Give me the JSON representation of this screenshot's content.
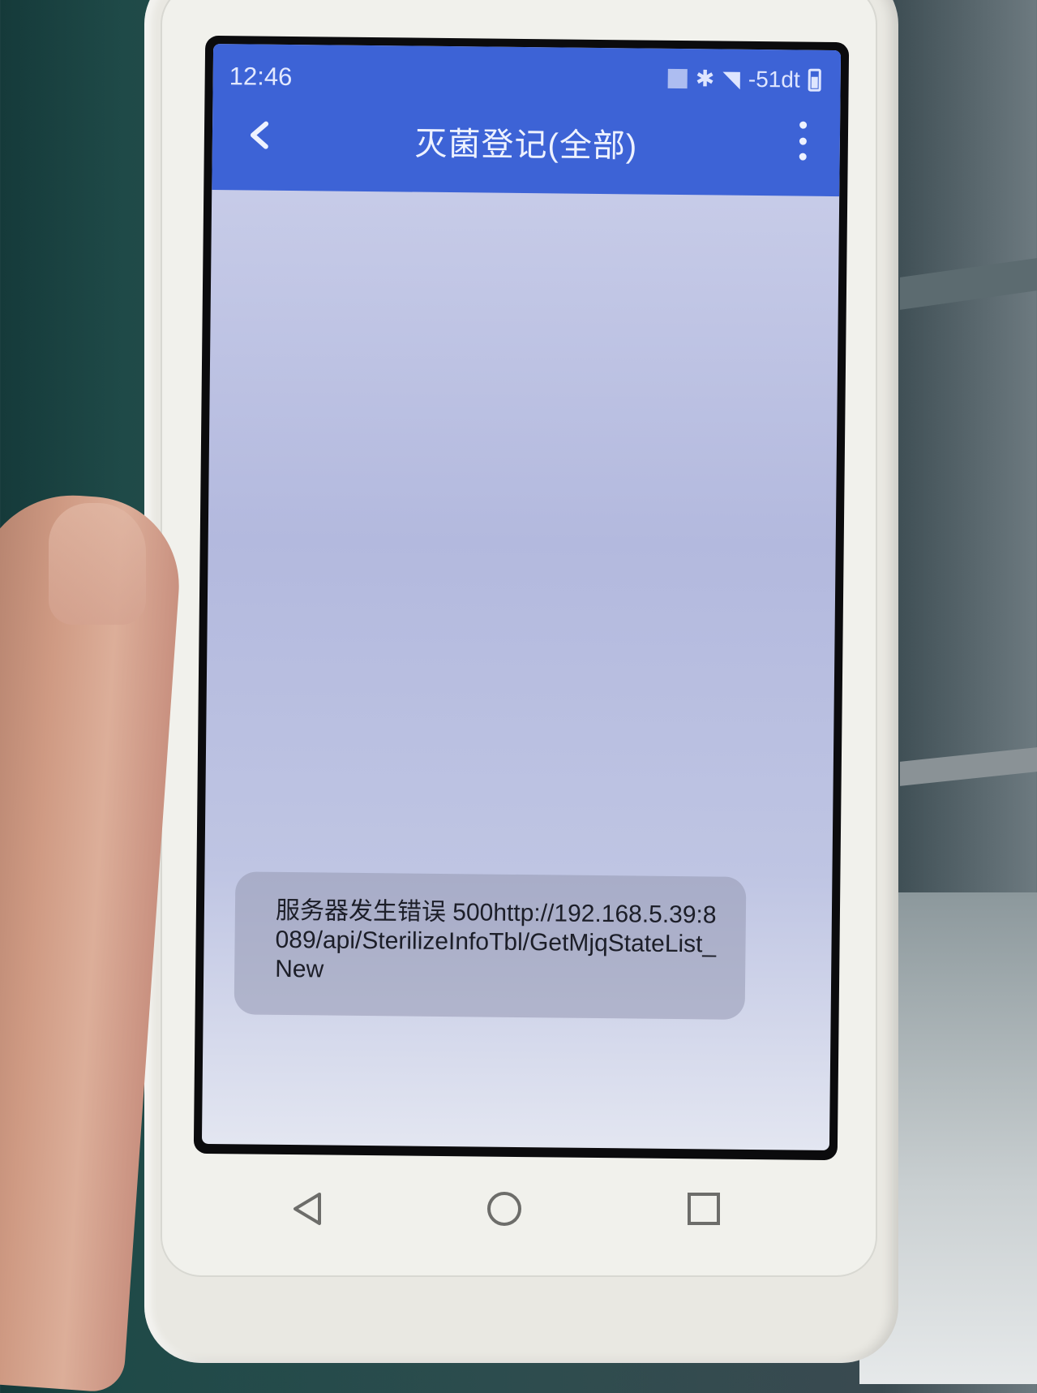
{
  "status_bar": {
    "time": "12:46",
    "signal_text": "-51dt"
  },
  "app_bar": {
    "title": "灭菌登记(全部)",
    "color": "#3d63d6"
  },
  "toast": {
    "message": "服务器发生错误 500http://192.168.5.39:8089/api/SterilizeInfoTbl/GetMjqStateList_New"
  },
  "icons": {
    "back": "chevron-left-icon",
    "more": "more-vert-icon",
    "nav_back": "triangle-back-icon",
    "nav_home": "circle-home-icon",
    "nav_recent": "square-recent-icon"
  }
}
